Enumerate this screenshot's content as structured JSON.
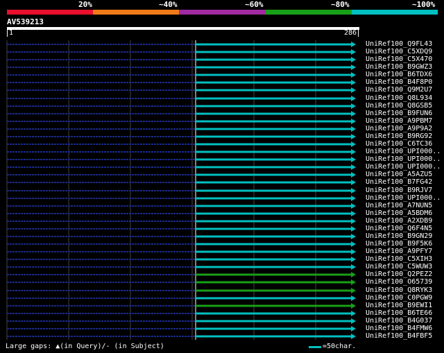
{
  "legend": {
    "labels": [
      "20%",
      "~40%",
      "~60%",
      "~80%",
      "~100%"
    ],
    "colors": [
      "#e8102c",
      "#f07a18",
      "#a02aa0",
      "#18a018",
      "#00c0c0"
    ]
  },
  "query": {
    "name": "AV539213",
    "start_label": "1",
    "end_label": "286"
  },
  "hits": [
    {
      "name": "UniRef100_Q9FL43",
      "color": "#00c0c0"
    },
    {
      "name": "UniRef100_C5XDQ9",
      "color": "#00c0c0"
    },
    {
      "name": "UniRef100_C5X470",
      "color": "#00c0c0"
    },
    {
      "name": "UniRef100_B9GWZ3",
      "color": "#00c0c0"
    },
    {
      "name": "UniRef100_B6TDX6",
      "color": "#00c0c0"
    },
    {
      "name": "UniRef100_B4F8P0",
      "color": "#00c0c0"
    },
    {
      "name": "UniRef100_Q9M2U7",
      "color": "#00c0c0"
    },
    {
      "name": "UniRef100_Q8L934",
      "color": "#00c0c0"
    },
    {
      "name": "UniRef100_Q8GSB5",
      "color": "#00c0c0"
    },
    {
      "name": "UniRef100_B9FUN6",
      "color": "#00c0c0"
    },
    {
      "name": "UniRef100_A9PBM7",
      "color": "#00c0c0"
    },
    {
      "name": "UniRef100_A9P9A2",
      "color": "#00c0c0"
    },
    {
      "name": "UniRef100_B9RG92",
      "color": "#00c0c0"
    },
    {
      "name": "UniRef100_C6TC36",
      "color": "#00c0c0"
    },
    {
      "name": "UniRef100_UPI000..",
      "color": "#00c0c0"
    },
    {
      "name": "UniRef100_UPI000..",
      "color": "#00c0c0"
    },
    {
      "name": "UniRef100_UPI000..",
      "color": "#00c0c0"
    },
    {
      "name": "UniRef100_A5AZU5",
      "color": "#00c0c0"
    },
    {
      "name": "UniRef100_B7FG42",
      "color": "#00c0c0"
    },
    {
      "name": "UniRef100_B9RJV7",
      "color": "#00c0c0"
    },
    {
      "name": "UniRef100_UPI000..",
      "color": "#00c0c0"
    },
    {
      "name": "UniRef100_A7NUN5",
      "color": "#00c0c0"
    },
    {
      "name": "UniRef100_A5BDM6",
      "color": "#00c0c0"
    },
    {
      "name": "UniRef100_A2XDB9",
      "color": "#00c0c0"
    },
    {
      "name": "UniRef100_Q6F4N5",
      "color": "#00c0c0"
    },
    {
      "name": "UniRef100_B9GN29",
      "color": "#00c0c0"
    },
    {
      "name": "UniRef100_B9F5K6",
      "color": "#00c0c0"
    },
    {
      "name": "UniRef100_A9PFY7",
      "color": "#00c0c0"
    },
    {
      "name": "UniRef100_C5XIH3",
      "color": "#00c0c0"
    },
    {
      "name": "UniRef100_C5WUW3",
      "color": "#00c0c0"
    },
    {
      "name": "UniRef100_Q2PEZ2",
      "color": "#18a018"
    },
    {
      "name": "UniRef100_O65739",
      "color": "#18a018"
    },
    {
      "name": "UniRef100_Q8RYK3",
      "color": "#18a018"
    },
    {
      "name": "UniRef100_C0PGW9",
      "color": "#00c0c0"
    },
    {
      "name": "UniRef100_B9EWI1",
      "color": "#18a018"
    },
    {
      "name": "UniRef100_B6TE66",
      "color": "#00c0c0"
    },
    {
      "name": "UniRef100_B4G037",
      "color": "#00c0c0"
    },
    {
      "name": "UniRef100_B4FMW6",
      "color": "#00c0c0"
    },
    {
      "name": "UniRef100_B4FBF5",
      "color": "#00c0c0"
    }
  ],
  "footer": {
    "gaps_text": "Large gaps: ▲(in Query)/- (in Subject)",
    "scale_text": "=50char."
  },
  "colors": {
    "background": "#000000",
    "dashed_line": "#1a2a8a",
    "grid": "#444444"
  }
}
